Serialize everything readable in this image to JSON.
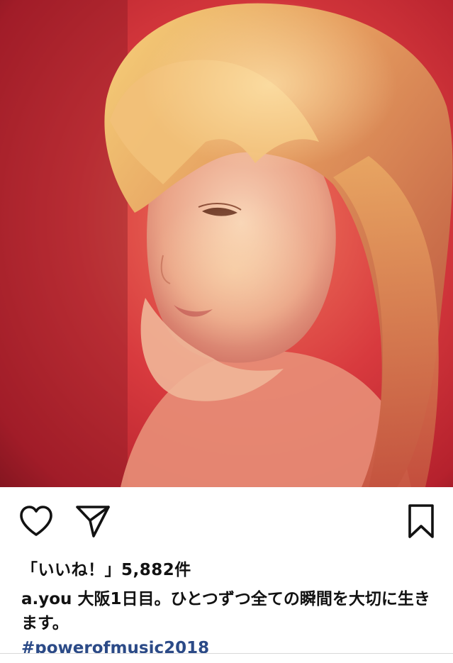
{
  "post": {
    "photo_icon": "portrait-photo",
    "actions": {
      "like_icon": "heart-icon",
      "share_icon": "paper-plane-icon",
      "save_icon": "bookmark-icon"
    },
    "likes_text": "「いいね！」5,882件",
    "caption": {
      "username": "a.you",
      "text": "大阪1日目。ひとつずつ全ての瞬間を大切に生きます。"
    },
    "hashtag": "#powerofmusic2018"
  },
  "colors": {
    "text": "#121212",
    "hashtag": "#2b4a87",
    "photo_red": "#d8333a",
    "photo_glow": "#f3b08a"
  }
}
